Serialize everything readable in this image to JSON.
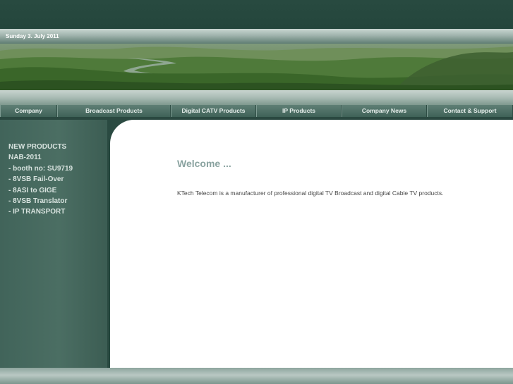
{
  "header": {
    "date": "Sunday 3. July 2011"
  },
  "nav": {
    "items": [
      {
        "label": "Company"
      },
      {
        "label": "Broadcast Products"
      },
      {
        "label": "Digital CATV Products"
      },
      {
        "label": "IP Products"
      },
      {
        "label": "Company News"
      },
      {
        "label": "Contact & Support"
      }
    ]
  },
  "sidebar": {
    "items": [
      {
        "label": "NEW PRODUCTS"
      },
      {
        "label": "NAB-2011"
      },
      {
        "label": "- booth no: SU9719"
      },
      {
        "label": "- 8VSB Fail-Over"
      },
      {
        "label": "- 8ASI to GIGE"
      },
      {
        "label": "- 8VSB Translator"
      },
      {
        "label": "- IP TRANSPORT"
      }
    ]
  },
  "main": {
    "heading": "Welcome ...",
    "intro": "KTech Telecom is a manufacturer of professional digital TV Broadcast and digital Cable TV products."
  }
}
